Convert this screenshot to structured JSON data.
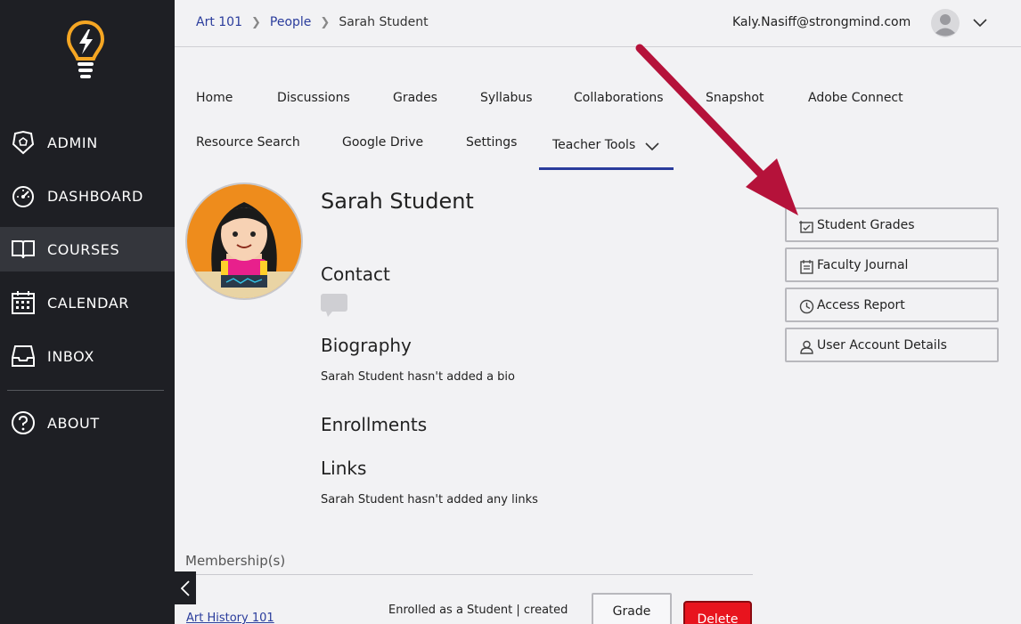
{
  "sidebar": {
    "items": [
      {
        "label": "ADMIN",
        "icon": "admin-badge-icon"
      },
      {
        "label": "DASHBOARD",
        "icon": "speedometer-icon"
      },
      {
        "label": "COURSES",
        "icon": "book-icon",
        "active": true
      },
      {
        "label": "CALENDAR",
        "icon": "calendar-icon"
      },
      {
        "label": "INBOX",
        "icon": "inbox-icon"
      },
      {
        "label": "ABOUT",
        "icon": "question-circle-icon"
      }
    ]
  },
  "breadcrumb": {
    "items": [
      "Art 101",
      "People"
    ],
    "current": "Sarah Student"
  },
  "user": {
    "email": "Kaly.Nasiff@strongmind.com"
  },
  "tabs": [
    "Home",
    "Discussions",
    "Grades",
    "Syllabus",
    "Collaborations",
    "Snapshot",
    "Adobe Connect",
    "Resource Search",
    "Google Drive",
    "Settings"
  ],
  "teacher_tools_label": "Teacher Tools",
  "profile": {
    "name": "Sarah Student",
    "contact_heading": "Contact",
    "bio_heading": "Biography",
    "bio_text": "Sarah Student hasn't added a bio",
    "enrollments_heading": "Enrollments",
    "links_heading": "Links",
    "links_text": "Sarah Student hasn't added any links"
  },
  "actions": [
    {
      "label": "Student Grades",
      "icon": "grades-check-icon"
    },
    {
      "label": "Faculty Journal",
      "icon": "journal-icon"
    },
    {
      "label": "Access Report",
      "icon": "clock-icon"
    },
    {
      "label": "User Account Details",
      "icon": "user-icon"
    }
  ],
  "membership": {
    "title": "Membership(s)",
    "course": "Art History 101",
    "status": "Enrolled as a Student | created",
    "grade_label": "Grade",
    "delete_label": "Delete"
  },
  "colors": {
    "sidebar": "#1e1f24",
    "link": "#2a3c9c",
    "accent_orange": "#f5a623",
    "danger": "#e8141e",
    "annotation_arrow": "#b5123a"
  }
}
